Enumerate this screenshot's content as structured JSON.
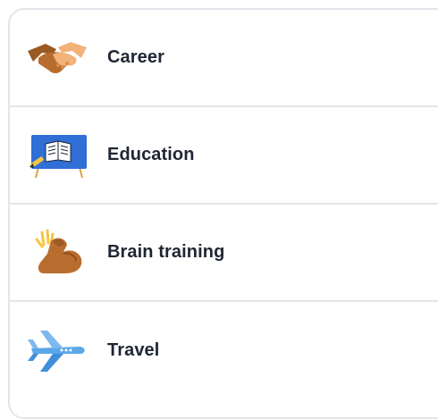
{
  "topics": {
    "items": [
      {
        "label": "Career",
        "icon": "handshake-icon"
      },
      {
        "label": "Education",
        "icon": "book-on-blackboard-icon"
      },
      {
        "label": "Brain training",
        "icon": "flexed-biceps-icon"
      },
      {
        "label": "Travel",
        "icon": "airplane-icon"
      }
    ]
  },
  "colors": {
    "divider": "#e2e5ea",
    "text": "#1f2633",
    "board_blue": "#2f6fd6",
    "skin_light": "#f2b27a",
    "skin_dark": "#9a5a24",
    "plane_blue": "#5aa7e8"
  }
}
